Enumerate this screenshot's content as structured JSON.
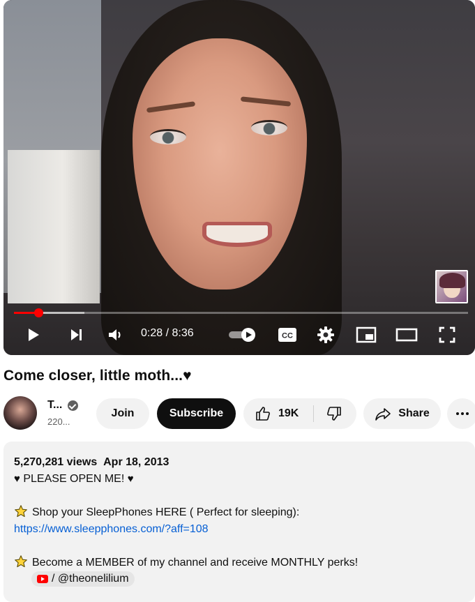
{
  "player": {
    "current_time": "0:28",
    "duration": "8:36",
    "time_separator": " / ",
    "progress_fraction": 0.0543,
    "buffered_fraction": 0.155,
    "controls": [
      "play-icon",
      "next-icon",
      "volume-icon",
      "autoplay-toggle",
      "captions-icon",
      "settings-icon",
      "miniplayer-icon",
      "theater-icon",
      "fullscreen-icon"
    ],
    "captions_label": "CC",
    "accent_color": "#ff0000"
  },
  "video": {
    "title": "Come closer, little moth...",
    "title_suffix": "♥"
  },
  "channel": {
    "name": "T...",
    "subscribers": "220..."
  },
  "actions": {
    "join_label": "Join",
    "subscribe_label": "Subscribe",
    "like_count": "19K",
    "share_label": "Share"
  },
  "description": {
    "views": "5,270,281 views",
    "date": "Apr 18, 2013",
    "line1_prefix": "♥",
    "line1_text": " PLEASE OPEN ME! ",
    "line1_suffix": "♥",
    "line2": "Shop your SleepPhones HERE ( Perfect for sleeping):",
    "link": "https://www.sleepphones.com/?aff=108",
    "line3": "Become a MEMBER of my channel and receive MONTHLY perks!",
    "handle_chip": "/ @theonelilium"
  }
}
